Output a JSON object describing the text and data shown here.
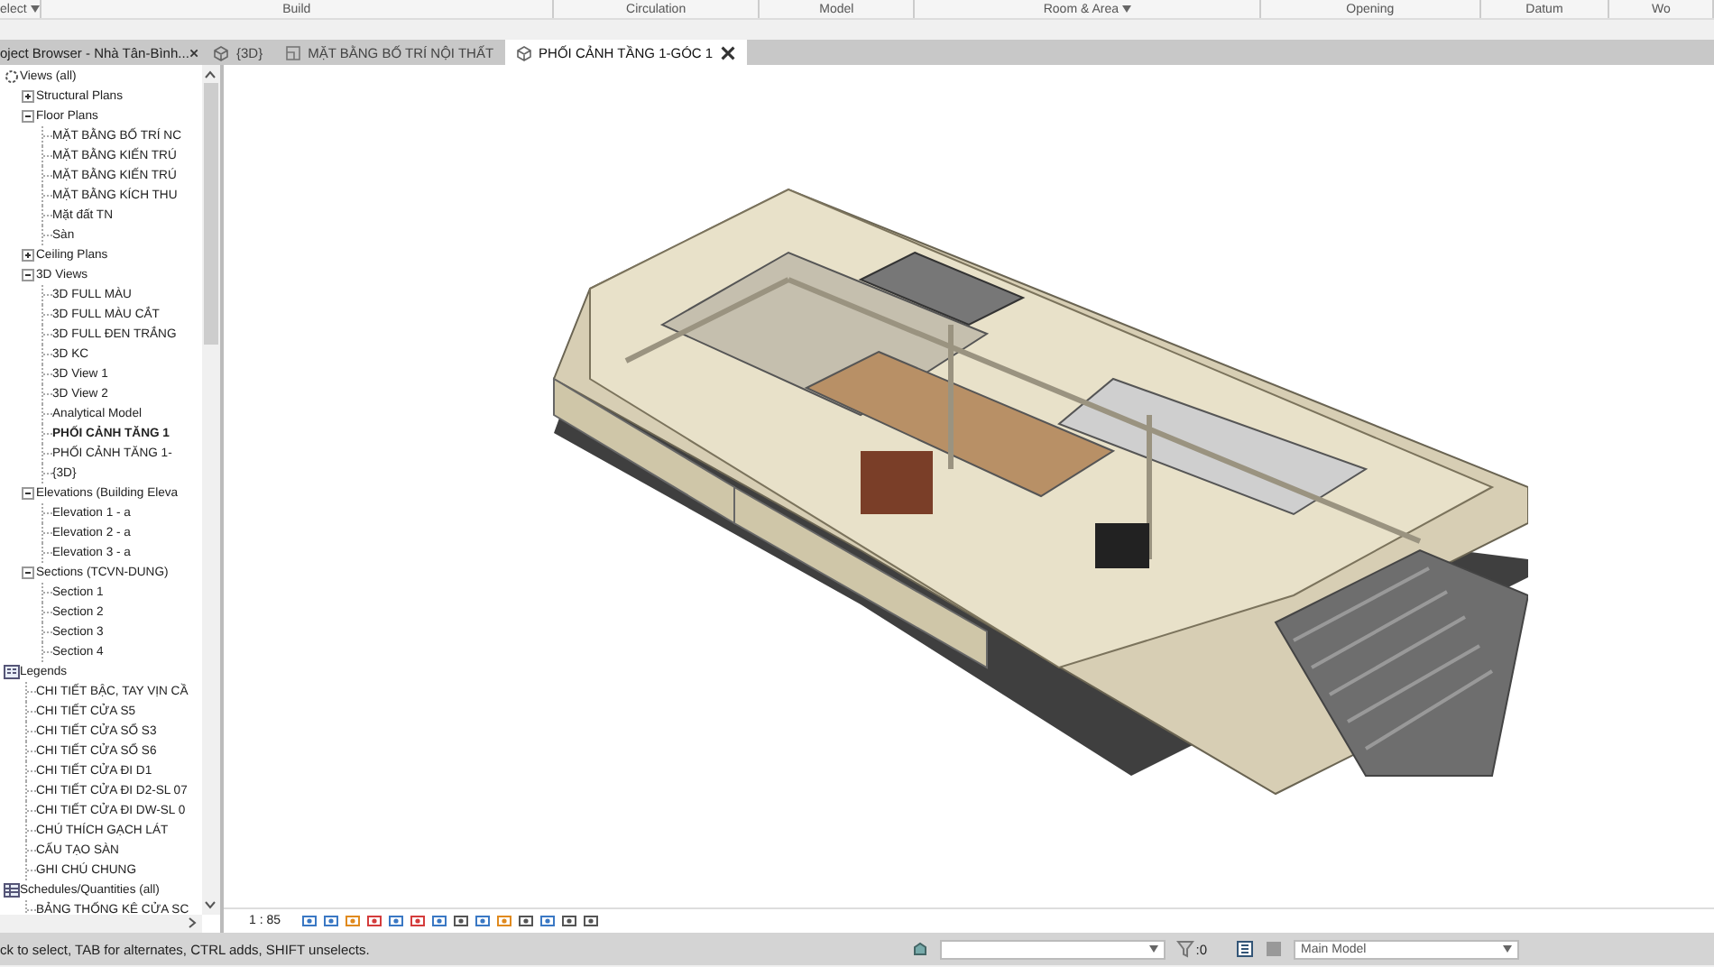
{
  "ribbon": {
    "panels": [
      {
        "label": "elect",
        "dropdown": true
      },
      {
        "label": "Build",
        "dropdown": false
      },
      {
        "label": "Circulation",
        "dropdown": false
      },
      {
        "label": "Model",
        "dropdown": false
      },
      {
        "label": "Room & Area",
        "dropdown": true
      },
      {
        "label": "Opening",
        "dropdown": false
      },
      {
        "label": "Datum",
        "dropdown": false
      },
      {
        "label": "Wo",
        "dropdown": false
      }
    ]
  },
  "project_browser": {
    "title": "oject Browser - Nhà Tân-Bình...",
    "tree": [
      {
        "label": "Views (all)",
        "kind": "root",
        "expanded": true,
        "selected": false,
        "children": [
          {
            "label": "Structural Plans",
            "kind": "folder",
            "expanded": false,
            "selected": false
          },
          {
            "label": "Floor Plans",
            "kind": "folder",
            "expanded": true,
            "selected": false,
            "children": [
              {
                "label": "MẶT BẰNG BỐ TRÍ NC",
                "kind": "view",
                "selected": false
              },
              {
                "label": "MẶT BẰNG KIẾN TRÚ",
                "kind": "view",
                "selected": false
              },
              {
                "label": "MẶT BẰNG KIẾN TRÚ",
                "kind": "view",
                "selected": false
              },
              {
                "label": "MẶT BẰNG KÍCH THU",
                "kind": "view",
                "selected": false
              },
              {
                "label": "Mặt đất TN",
                "kind": "view",
                "selected": false
              },
              {
                "label": "Sàn",
                "kind": "view",
                "selected": false
              }
            ]
          },
          {
            "label": "Ceiling Plans",
            "kind": "folder",
            "expanded": false,
            "selected": false
          },
          {
            "label": "3D Views",
            "kind": "folder",
            "expanded": true,
            "selected": false,
            "children": [
              {
                "label": "3D FULL MÀU",
                "kind": "view",
                "selected": false
              },
              {
                "label": "3D FULL MÀU CẮT",
                "kind": "view",
                "selected": false
              },
              {
                "label": "3D FULL ĐEN TRẮNG",
                "kind": "view",
                "selected": false
              },
              {
                "label": "3D KC",
                "kind": "view",
                "selected": false
              },
              {
                "label": "3D View 1",
                "kind": "view",
                "selected": false
              },
              {
                "label": "3D View 2",
                "kind": "view",
                "selected": false
              },
              {
                "label": "Analytical Model",
                "kind": "view",
                "selected": false
              },
              {
                "label": "PHỐI CẢNH TĂNG 1",
                "kind": "view",
                "selected": true
              },
              {
                "label": "PHỐI CẢNH TĂNG 1-",
                "kind": "view",
                "selected": false
              },
              {
                "label": "{3D}",
                "kind": "view",
                "selected": false
              }
            ]
          },
          {
            "label": "Elevations (Building Eleva",
            "kind": "folder",
            "expanded": true,
            "selected": false,
            "children": [
              {
                "label": "Elevation 1 - a",
                "kind": "view",
                "selected": false
              },
              {
                "label": "Elevation 2 - a",
                "kind": "view",
                "selected": false
              },
              {
                "label": "Elevation 3 - a",
                "kind": "view",
                "selected": false
              }
            ]
          },
          {
            "label": "Sections (TCVN-DUNG)",
            "kind": "folder",
            "expanded": true,
            "selected": false,
            "children": [
              {
                "label": "Section 1",
                "kind": "view",
                "selected": false
              },
              {
                "label": "Section 2",
                "kind": "view",
                "selected": false
              },
              {
                "label": "Section 3",
                "kind": "view",
                "selected": false
              },
              {
                "label": "Section 4",
                "kind": "view",
                "selected": false
              }
            ]
          }
        ]
      },
      {
        "label": "Legends",
        "kind": "legend",
        "expanded": true,
        "selected": false,
        "children": [
          {
            "label": "CHI TIẾT BẬC, TAY VỊN CẦ",
            "kind": "view",
            "selected": false
          },
          {
            "label": "CHI TIẾT CỬA S5",
            "kind": "view",
            "selected": false
          },
          {
            "label": "CHI TIẾT CỬA SỔ S3",
            "kind": "view",
            "selected": false
          },
          {
            "label": "CHI TIẾT CỬA SỔ S6",
            "kind": "view",
            "selected": false
          },
          {
            "label": "CHI TIẾT CỬA ĐI D1",
            "kind": "view",
            "selected": false
          },
          {
            "label": "CHI TIẾT CỬA ĐI D2-SL 07",
            "kind": "view",
            "selected": false
          },
          {
            "label": "CHI TIẾT CỬA ĐI DW-SL 0",
            "kind": "view",
            "selected": false
          },
          {
            "label": "CHÚ THÍCH GẠCH LÁT",
            "kind": "view",
            "selected": false
          },
          {
            "label": "CẤU TẠO SÀN",
            "kind": "view",
            "selected": false
          },
          {
            "label": "GHI CHÚ CHUNG",
            "kind": "view",
            "selected": false
          }
        ]
      },
      {
        "label": "Schedules/Quantities (all)",
        "kind": "schedule",
        "expanded": true,
        "selected": false,
        "children": [
          {
            "label": "BẢNG THỐNG KÊ CỬA SC",
            "kind": "view",
            "selected": false
          }
        ]
      }
    ]
  },
  "tabs": [
    {
      "label": "{3D}",
      "kind": "model",
      "selected": false,
      "closable": false
    },
    {
      "label": "MẶT BẰNG BỐ TRÍ NỘI THẤT",
      "kind": "plan",
      "selected": false,
      "closable": false
    },
    {
      "label": "PHỐI CẢNH TẦNG 1-GÓC 1",
      "kind": "model",
      "selected": true,
      "closable": true
    }
  ],
  "view_bar": {
    "scale": "1 : 85"
  },
  "status_bar": {
    "message": "ck to select, TAB for alternates, CTRL adds, SHIFT unselects.",
    "filter_count": ":0",
    "model": "Main Model"
  }
}
